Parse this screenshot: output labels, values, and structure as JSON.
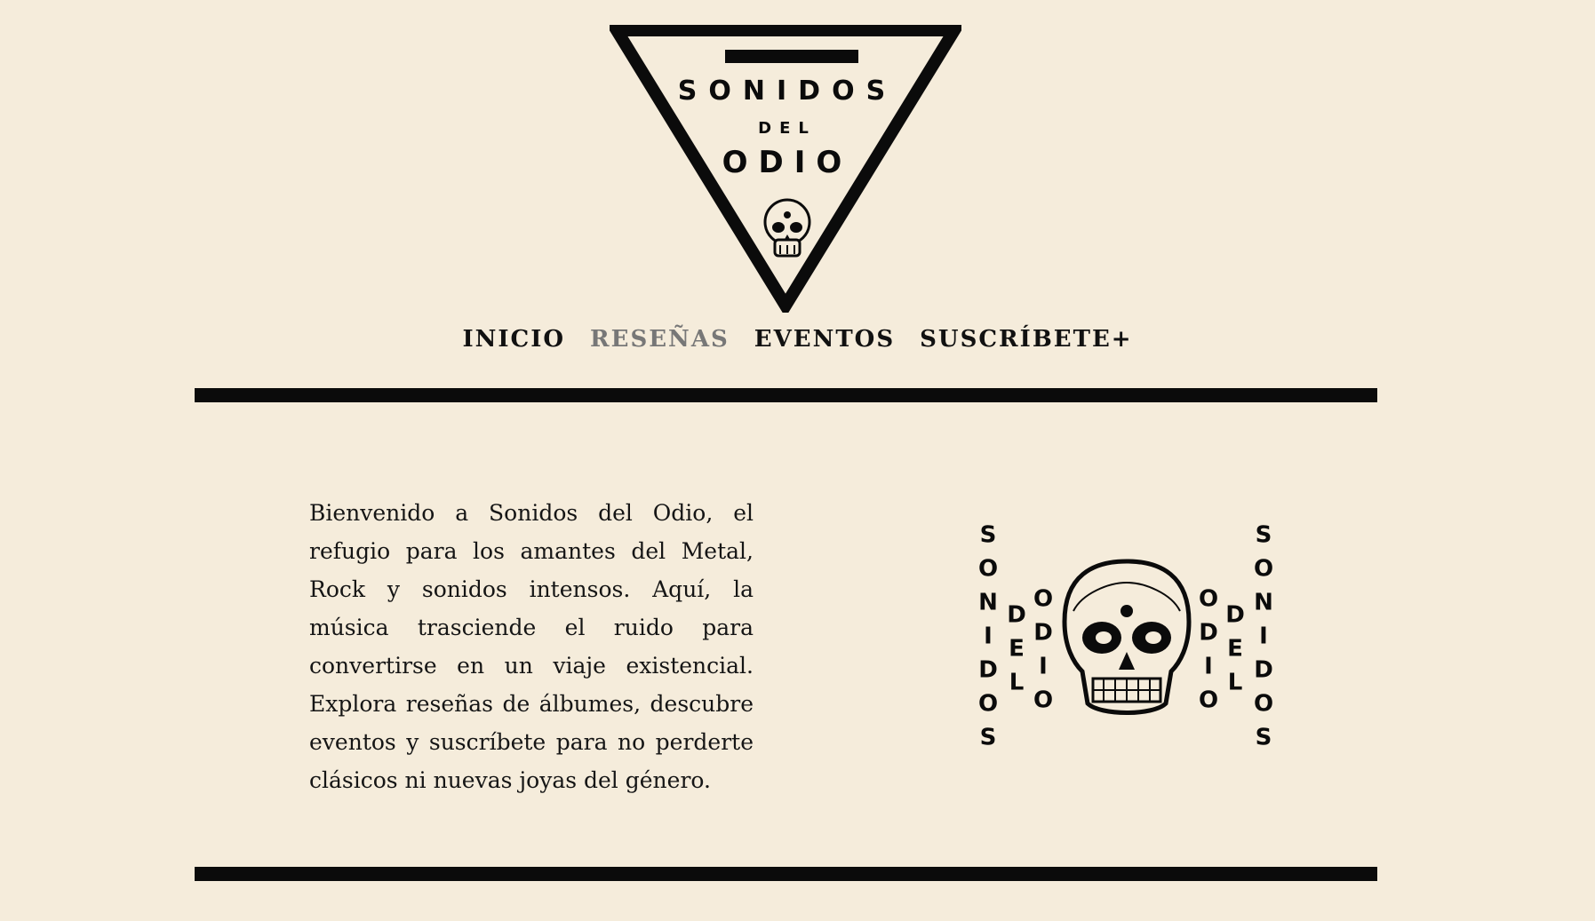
{
  "logo": {
    "line1": "SONIDOS",
    "line2": "DEL",
    "line3": "ODIO",
    "icon": "skull-icon"
  },
  "nav": {
    "items": [
      {
        "label": "INICIO",
        "active": false
      },
      {
        "label": "RESEÑAS",
        "active": true
      },
      {
        "label": "EVENTOS",
        "active": false
      },
      {
        "label": "SUSCRÍBETE+",
        "active": false
      }
    ]
  },
  "main": {
    "intro": "Bienvenido a Sonidos del Odio, el refugio para los amantes del Metal, Rock y sonidos intensos. Aquí, la música trasciende el ruido para convertirse en un viaje existencial. Explora reseñas de álbumes, descubre eventos y suscríbete para no perderte clásicos ni nuevas joyas del género.",
    "art": {
      "outer_text": "SONIDOS",
      "middle_text": "DEL",
      "inner_text": "ODIO",
      "icon": "skull-icon"
    }
  },
  "colors": {
    "background": "#f5ecdb",
    "ink": "#0b0b0b",
    "nav_active": "#777777"
  }
}
